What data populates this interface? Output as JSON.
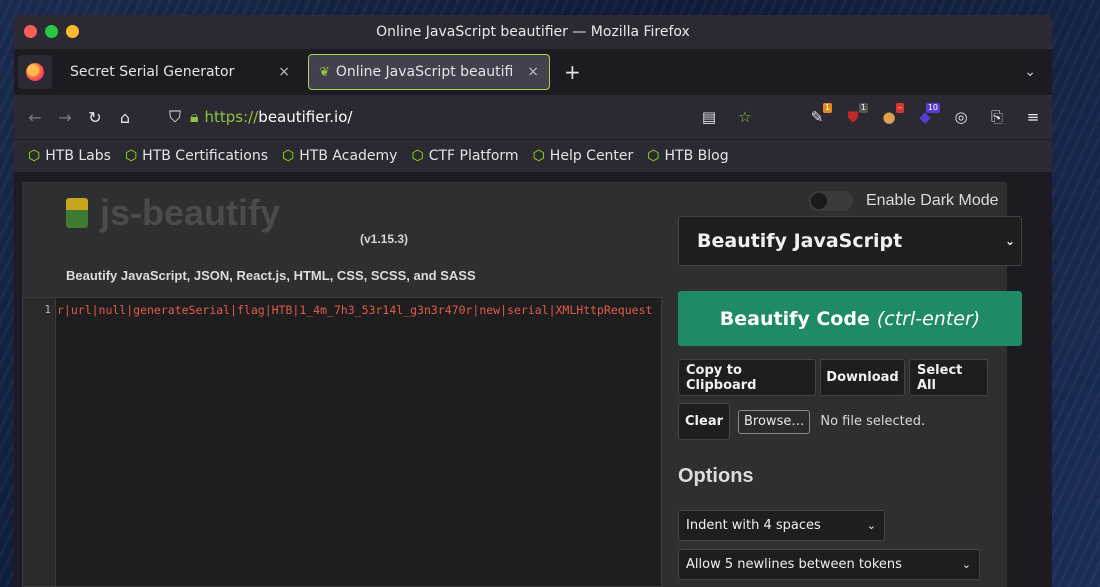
{
  "window": {
    "title": "Online JavaScript beautifier — Mozilla Firefox"
  },
  "tabs": [
    {
      "label": "Secret Serial Generator",
      "close": "×"
    },
    {
      "label": "Online JavaScript beautifi",
      "close": "×"
    }
  ],
  "new_tab": "+",
  "tab_list": "⌄",
  "nav": {
    "url_prefix": "https://",
    "url_domain": "beautifier.io/",
    "extensions": [
      {
        "name": "ext-1",
        "badge": "1",
        "badge_color": "#e88a1a"
      },
      {
        "name": "ublock",
        "badge": "1",
        "badge_color": "#555555"
      },
      {
        "name": "ext-blocked",
        "badge": "",
        "badge_color": "#d33"
      },
      {
        "name": "ext-10",
        "badge": "10",
        "badge_color": "#5a3bd1"
      }
    ]
  },
  "bookmarks": [
    "HTB Labs",
    "HTB Certifications",
    "HTB Academy",
    "CTF Platform",
    "Help Center",
    "HTB Blog"
  ],
  "page": {
    "logo_text": "js-beautify",
    "version": "(v1.15.3)",
    "subtitle": "Beautify JavaScript, JSON, React.js, HTML, CSS, SCSS, and SASS",
    "dark_mode_label": "Enable Dark Mode",
    "language_select": "Beautify JavaScript",
    "beautify_label": "Beautify Code",
    "beautify_shortcut": "(ctrl-enter)",
    "buttons": {
      "copy": "Copy to Clipboard",
      "download": "Download",
      "select_all": "Select All",
      "clear": "Clear",
      "browse": "Browse…"
    },
    "no_file": "No file selected.",
    "options_title": "Options",
    "indent_select": "Indent with 4 spaces",
    "newlines_select": "Allow 5 newlines between tokens"
  },
  "editor": {
    "line_number": "1",
    "code": "r|url|null|generateSerial|flag|HTB|1_4m_7h3_53r14l_g3n3r470r|new|serial|XMLHttpRequest"
  },
  "colors": {
    "accent": "#1f8a66",
    "url_green": "#8ec63f",
    "htb_green": "#9fef00",
    "code_red": "#e25a4a"
  }
}
